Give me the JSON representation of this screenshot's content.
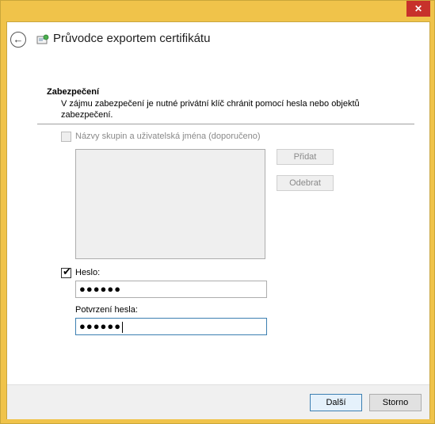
{
  "window": {
    "close_glyph": "✕"
  },
  "header": {
    "back_glyph": "←",
    "title": "Průvodce exportem certifikátu",
    "icon": "certificate-wizard-icon"
  },
  "section": {
    "title": "Zabezpečení",
    "description": "V zájmu zabezpečení je nutné privátní klíč chránit pomocí hesla nebo objektů zabezpečení."
  },
  "groups_checkbox": {
    "label": "Názvy skupin a uživatelská jména (doporučeno)",
    "checked": false,
    "enabled": false
  },
  "buttons": {
    "add": "Přidat",
    "remove": "Odebrat",
    "next": "Další",
    "cancel": "Storno"
  },
  "password": {
    "label": "Heslo:",
    "checked": true,
    "value": "●●●●●●"
  },
  "confirm": {
    "label": "Potvrzení hesla:",
    "value": "●●●●●●"
  }
}
